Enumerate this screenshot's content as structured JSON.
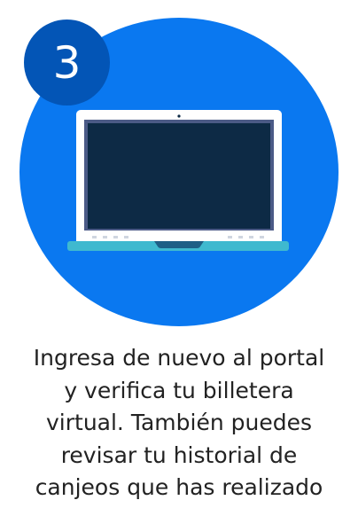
{
  "step": {
    "number": "3",
    "icon": "laptop-icon",
    "caption_lines": [
      "Ingresa de nuevo al portal",
      "y verifica tu billetera",
      "virtual. También puedes",
      "revisar tu historial de",
      "canjeos que has realizado"
    ]
  },
  "colors": {
    "circle": "#0a78f0",
    "badge": "#0355b6",
    "laptop_frame": "#ffffff",
    "laptop_screen": "#0d2a45",
    "laptop_bezel": "#4b5a86",
    "laptop_base": "#3fb9cf",
    "caption_text": "#222222"
  }
}
